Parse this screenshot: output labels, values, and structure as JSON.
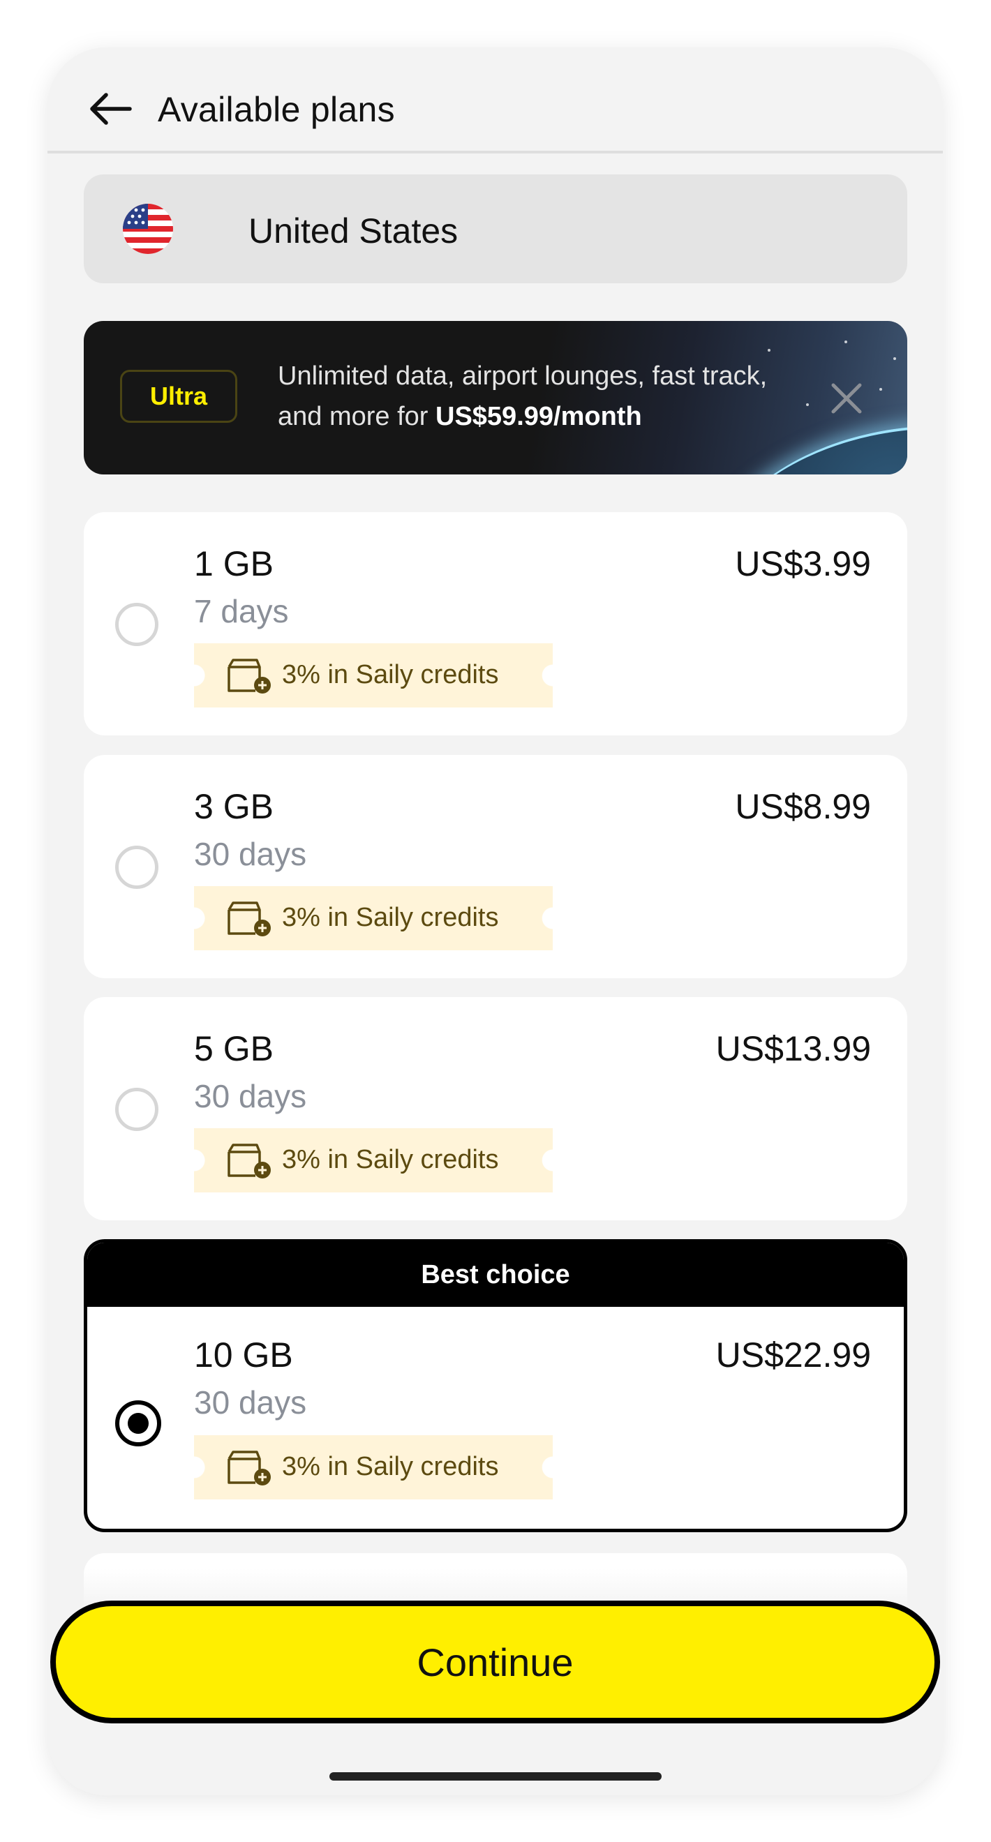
{
  "header": {
    "title": "Available plans"
  },
  "country": {
    "name": "United States"
  },
  "promo": {
    "badge": "Ultra",
    "text_line": "Unlimited data, airport lounges, fast track, and more for ",
    "price_text": "US$59.99/month"
  },
  "plans": [
    {
      "amount": "1 GB",
      "duration": "7 days",
      "price": "US$3.99",
      "credits": "3% in Saily credits",
      "selected": false
    },
    {
      "amount": "3 GB",
      "duration": "30 days",
      "price": "US$8.99",
      "credits": "3% in Saily credits",
      "selected": false
    },
    {
      "amount": "5 GB",
      "duration": "30 days",
      "price": "US$13.99",
      "credits": "3% in Saily credits",
      "selected": false
    }
  ],
  "best_plan": {
    "label": "Best choice",
    "amount": "10 GB",
    "duration": "30 days",
    "price": "US$22.99",
    "credits": "3% in Saily credits",
    "selected": true
  },
  "cta": {
    "label": "Continue"
  },
  "colors": {
    "accent": "#ffef00",
    "credits_bg": "#fff4d9",
    "credits_text": "#5c4a10",
    "ultra_text": "#ffee00"
  },
  "icons": {
    "back": "arrow-left-icon",
    "close": "close-icon",
    "credits": "wallet-plus-icon",
    "flag": "us-flag-icon"
  }
}
